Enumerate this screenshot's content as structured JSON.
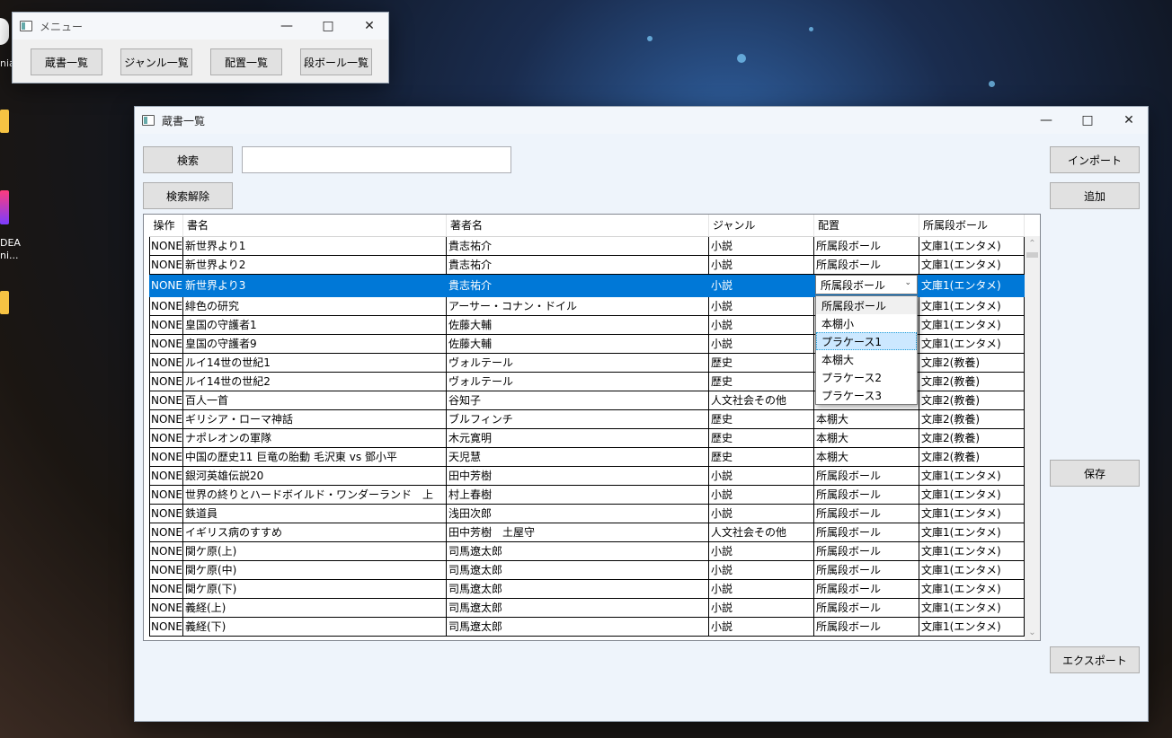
{
  "menu_window": {
    "title": "メニュー",
    "buttons": [
      "蔵書一覧",
      "ジャンル一覧",
      "配置一覧",
      "段ボール一覧"
    ]
  },
  "main_window": {
    "title": "蔵書一覧",
    "search_button": "検索",
    "clear_search_button": "検索解除",
    "search_value": "",
    "import_button": "インポート",
    "add_button": "追加",
    "save_button": "保存",
    "export_button": "エクスポート"
  },
  "desktop": {
    "labels": [
      "nia",
      "DEA",
      "ni..."
    ]
  },
  "grid": {
    "columns": [
      "操作",
      "書名",
      "著者名",
      "ジャンル",
      "配置",
      "所属段ボール"
    ],
    "selected_index": 2,
    "rows": [
      [
        "NONE",
        "新世界より1",
        "貴志祐介",
        "小説",
        "所属段ボール",
        "文庫1(エンタメ)"
      ],
      [
        "NONE",
        "新世界より2",
        "貴志祐介",
        "小説",
        "所属段ボール",
        "文庫1(エンタメ)"
      ],
      [
        "NONE",
        "新世界より3",
        "貴志祐介",
        "小説",
        "所属段ボール",
        "文庫1(エンタメ)"
      ],
      [
        "NONE",
        "緋色の研究",
        "アーサー・コナン・ドイル",
        "小説",
        "",
        "文庫1(エンタメ)"
      ],
      [
        "NONE",
        "皇国の守護者1",
        "佐藤大輔",
        "小説",
        "",
        "文庫1(エンタメ)"
      ],
      [
        "NONE",
        "皇国の守護者9",
        "佐藤大輔",
        "小説",
        "",
        "文庫1(エンタメ)"
      ],
      [
        "NONE",
        "ルイ14世の世紀1",
        "ヴォルテール",
        "歴史",
        "",
        "文庫2(教養)"
      ],
      [
        "NONE",
        "ルイ14世の世紀2",
        "ヴォルテール",
        "歴史",
        "",
        "文庫2(教養)"
      ],
      [
        "NONE",
        "百人一首",
        "谷知子",
        "人文社会その他",
        "",
        "文庫2(教養)"
      ],
      [
        "NONE",
        "ギリシア・ローマ神話",
        "ブルフィンチ",
        "歴史",
        "本棚大",
        "文庫2(教養)"
      ],
      [
        "NONE",
        "ナポレオンの軍隊",
        "木元寛明",
        "歴史",
        "本棚大",
        "文庫2(教養)"
      ],
      [
        "NONE",
        "中国の歴史11 巨竜の胎動 毛沢東 vs 鄧小平",
        "天児慧",
        "歴史",
        "本棚大",
        "文庫2(教養)"
      ],
      [
        "NONE",
        "銀河英雄伝説20",
        "田中芳樹",
        "小説",
        "所属段ボール",
        "文庫1(エンタメ)"
      ],
      [
        "NONE",
        "世界の終りとハードボイルド・ワンダーランド　上",
        "村上春樹",
        "小説",
        "所属段ボール",
        "文庫1(エンタメ)"
      ],
      [
        "NONE",
        "鉄道員",
        "浅田次郎",
        "小説",
        "所属段ボール",
        "文庫1(エンタメ)"
      ],
      [
        "NONE",
        "イギリス病のすすめ",
        "田中芳樹　土屋守",
        "人文社会その他",
        "所属段ボール",
        "文庫1(エンタメ)"
      ],
      [
        "NONE",
        "関ケ原(上)",
        "司馬遼太郎",
        "小説",
        "所属段ボール",
        "文庫1(エンタメ)"
      ],
      [
        "NONE",
        "関ケ原(中)",
        "司馬遼太郎",
        "小説",
        "所属段ボール",
        "文庫1(エンタメ)"
      ],
      [
        "NONE",
        "関ケ原(下)",
        "司馬遼太郎",
        "小説",
        "所属段ボール",
        "文庫1(エンタメ)"
      ],
      [
        "NONE",
        "義経(上)",
        "司馬遼太郎",
        "小説",
        "所属段ボール",
        "文庫1(エンタメ)"
      ],
      [
        "NONE",
        "義経(下)",
        "司馬遼太郎",
        "小説",
        "所属段ボール",
        "文庫1(エンタメ)"
      ]
    ]
  },
  "combo": {
    "value": "所属段ボール",
    "options": [
      "所属段ボール",
      "本棚小",
      "プラケース1",
      "本棚大",
      "プラケース2",
      "プラケース3"
    ],
    "highlighted_index": 2
  }
}
